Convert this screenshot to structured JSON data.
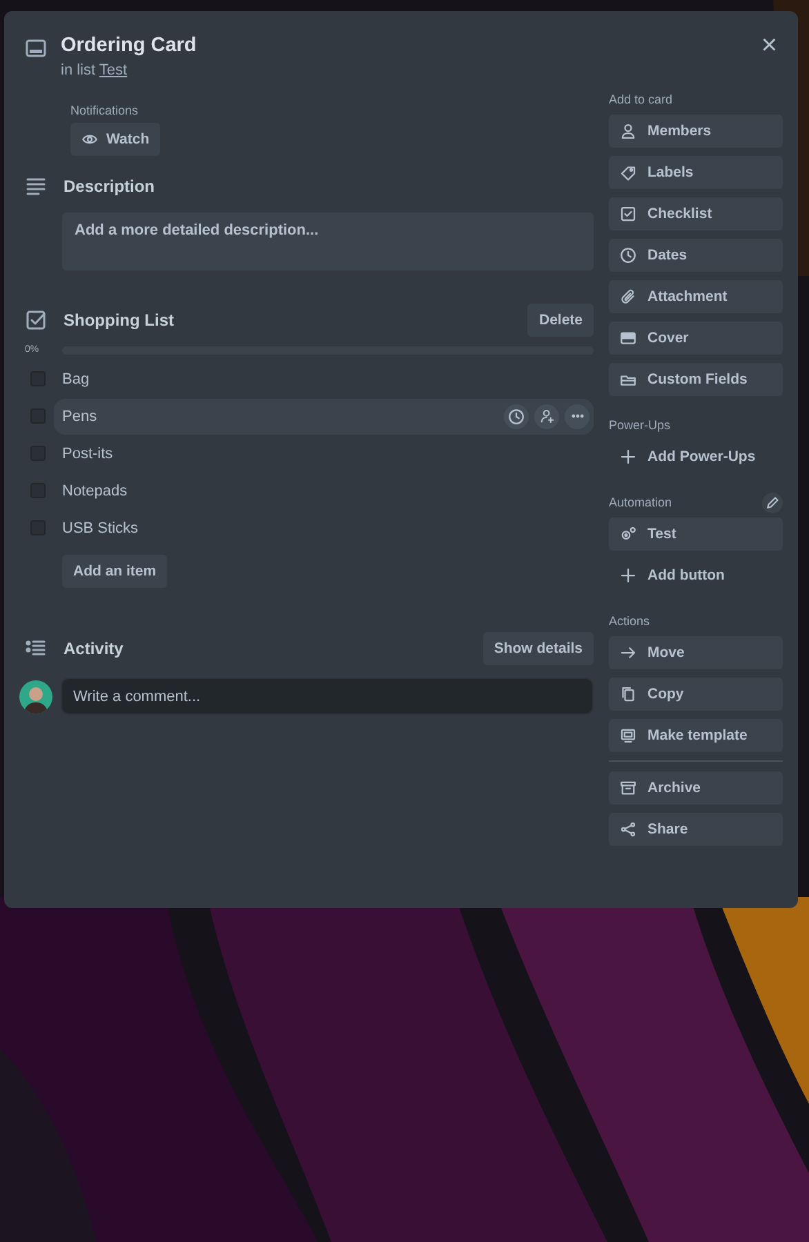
{
  "card": {
    "title": "Ordering Card",
    "list_prefix": "in list",
    "list_name": "Test",
    "close": "×"
  },
  "notifications": {
    "label": "Notifications",
    "button": "Watch"
  },
  "description": {
    "heading": "Description",
    "placeholder": "Add a more detailed description..."
  },
  "checklist": {
    "title": "Shopping List",
    "delete": "Delete",
    "percent": "0%",
    "level": 0,
    "items": [
      {
        "label": "Bag",
        "checked": false,
        "hovered": false
      },
      {
        "label": "Pens",
        "checked": false,
        "hovered": true
      },
      {
        "label": "Post-its",
        "checked": false,
        "hovered": false
      },
      {
        "label": "Notepads",
        "checked": false,
        "hovered": false
      },
      {
        "label": "USB Sticks",
        "checked": false,
        "hovered": false
      }
    ],
    "add_item": "Add an item"
  },
  "activity": {
    "heading": "Activity",
    "show_details": "Show details",
    "comment_placeholder": "Write a comment..."
  },
  "sidebar": [
    {
      "label": "Add to card",
      "edit": false,
      "items": [
        {
          "label": "Members",
          "kind": "button"
        },
        {
          "label": "Labels",
          "kind": "button"
        },
        {
          "label": "Checklist",
          "kind": "button"
        },
        {
          "label": "Dates",
          "kind": "button"
        },
        {
          "label": "Attachment",
          "kind": "button"
        },
        {
          "label": "Cover",
          "kind": "button"
        },
        {
          "label": "Custom Fields",
          "kind": "button"
        }
      ]
    },
    {
      "label": "Power-Ups",
      "edit": false,
      "items": [
        {
          "label": "Add Power-Ups",
          "kind": "add"
        }
      ]
    },
    {
      "label": "Automation",
      "edit": true,
      "items": [
        {
          "label": "Test",
          "kind": "button"
        },
        {
          "label": "Add button",
          "kind": "add"
        }
      ]
    },
    {
      "label": "Actions",
      "edit": false,
      "items": [
        {
          "label": "Move",
          "kind": "button"
        },
        {
          "label": "Copy",
          "kind": "button"
        },
        {
          "label": "Make template",
          "kind": "button"
        },
        {
          "label": "Archive",
          "kind": "button",
          "divider_before": true
        },
        {
          "label": "Share",
          "kind": "button"
        }
      ]
    }
  ]
}
